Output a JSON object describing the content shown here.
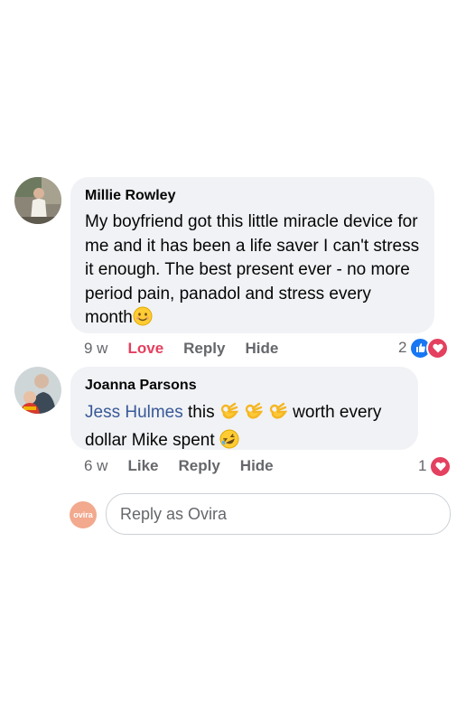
{
  "comments": [
    {
      "author": "Millie Rowley",
      "text": "My boyfriend got this little miracle device for me and it has been a life saver I can't stress it enough. The best present ever - no more period pain, panadol and stress every month",
      "emoji_icon": "smiling-face-emoji",
      "time": "9 w",
      "reaction_label": "Love",
      "reply_label": "Reply",
      "hide_label": "Hide",
      "reaction_count": "2",
      "reactions": [
        "like",
        "love"
      ]
    },
    {
      "author": "Joanna Parsons",
      "mention": "Jess Hulmes",
      "text_after_mention": " this",
      "emoji_ok": "ok-hand-emoji",
      "text_mid": "worth every dollar Mike spent",
      "emoji_end": "rolling-laughing-emoji",
      "time": "6 w",
      "reaction_label": "Like",
      "reply_label": "Reply",
      "hide_label": "Hide",
      "reaction_count": "1",
      "reactions": [
        "love"
      ]
    }
  ],
  "reply_box": {
    "logo_text": "ovira",
    "placeholder": "Reply as Ovira"
  },
  "colors": {
    "bubble": "#f0f2f5",
    "love": "#e4405f",
    "like": "#1877f2",
    "mention": "#385898",
    "ovira": "#f2a98e"
  }
}
